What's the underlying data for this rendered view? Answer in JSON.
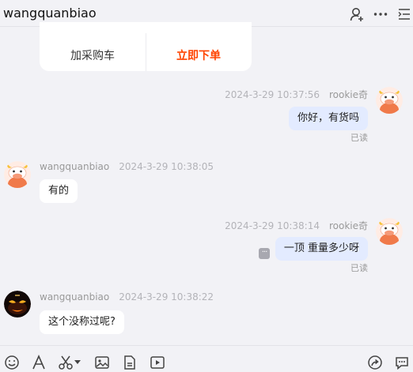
{
  "header": {
    "title": "wangquanbiao"
  },
  "product_card": {
    "cart_label": "加采购车",
    "buy_label": "立即下单"
  },
  "messages": [
    {
      "sender": "rookie奇",
      "time": "2024-3-29 10:37:56",
      "text": "你好，有货吗",
      "read": "已读"
    },
    {
      "sender": "wangquanbiao",
      "time": "2024-3-29 10:38:05",
      "text": "有的"
    },
    {
      "sender": "rookie奇",
      "time": "2024-3-29 10:38:14",
      "text": "一顶 重量多少呀",
      "read": "已读"
    },
    {
      "sender": "wangquanbiao",
      "time": "2024-3-29 10:38:22",
      "text": "这个没称过呢?"
    }
  ],
  "more_badge": "···",
  "colors": {
    "accent": "#ff4400",
    "outgoing_bubble": "#e3ebff",
    "background": "#f2f2f6"
  }
}
